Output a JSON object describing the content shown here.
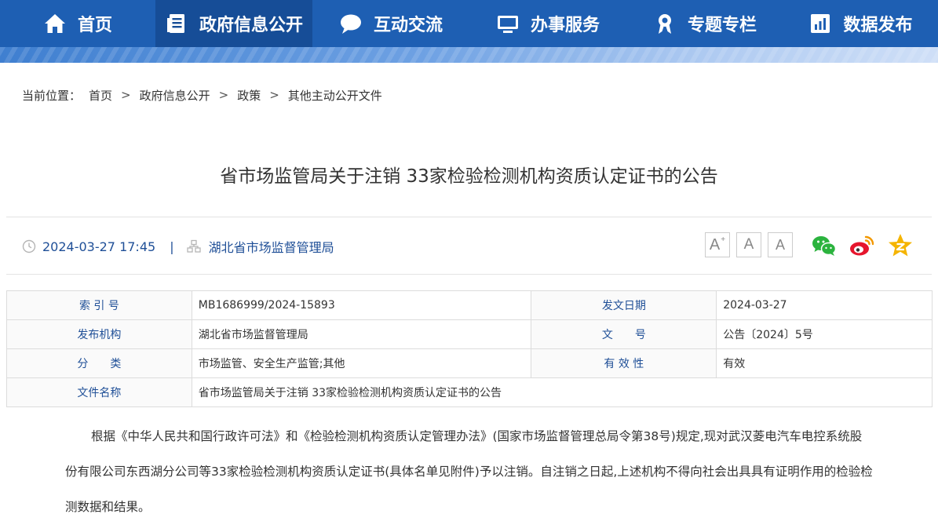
{
  "nav": {
    "items": [
      {
        "label": "首页",
        "icon": "home-icon"
      },
      {
        "label": "政府信息公开",
        "icon": "document-icon"
      },
      {
        "label": "互动交流",
        "icon": "chat-bubble-icon"
      },
      {
        "label": "办事服务",
        "icon": "monitor-icon"
      },
      {
        "label": "专题专栏",
        "icon": "award-icon"
      },
      {
        "label": "数据发布",
        "icon": "chart-icon"
      }
    ],
    "active_color": "#164d97",
    "bar_color": "#1e5fb3"
  },
  "breadcrumb": {
    "prefix": "当前位置：",
    "items": [
      "首页",
      "政府信息公开",
      "政策",
      "其他主动公开文件"
    ],
    "separator": ">"
  },
  "article": {
    "title": "省市场监管局关于注销 33家检验检测机构资质认定证书的公告",
    "date": "2024-03-27 17:45",
    "meta_separator": "|",
    "org": "湖北省市场监督管理局",
    "font_sizes": {
      "large": "A",
      "medium": "A",
      "small": "A",
      "large_sup": "+"
    }
  },
  "share": {
    "icons": [
      "wechat-icon",
      "weibo-icon",
      "qzone-icon"
    ]
  },
  "info_table": {
    "rows": [
      {
        "k1": "索 引 号",
        "v1": "MB1686999/2024-15893",
        "k2": "发文日期",
        "v2": "2024-03-27"
      },
      {
        "k1": "发布机构",
        "v1": "湖北省市场监督管理局",
        "k2": "文　　号",
        "v2": "公告〔2024〕5号"
      },
      {
        "k1": "分　　类",
        "v1": "市场监管、安全生产监管;其他",
        "k2": "有 效 性",
        "v2": "有效"
      },
      {
        "k1": "文件名称",
        "v1": "省市场监管局关于注销 33家检验检测机构资质认定证书的公告"
      }
    ]
  },
  "body": {
    "paragraph": "根据《中华人民共和国行政许可法》和《检验检测机构资质认定管理办法》(国家市场监督管理总局令第38号)规定,现对武汉菱电汽车电控系统股份有限公司东西湖分公司等33家检验检测机构资质认定证书(具体名单见附件)予以注销。自注销之日起,上述机构不得向社会出具具有证明作用的检验检测数据和结果。"
  }
}
